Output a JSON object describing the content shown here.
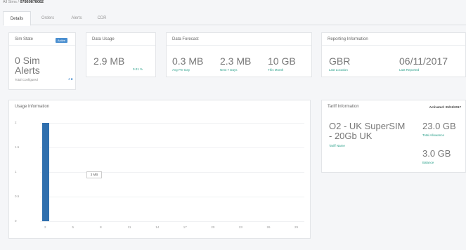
{
  "breadcrumb": {
    "root": "All Sims",
    "sep": "/",
    "current": "07860878082"
  },
  "tabs": [
    {
      "label": "Details",
      "active": true
    },
    {
      "label": "Orders",
      "active": false
    },
    {
      "label": "Alerts",
      "active": false
    },
    {
      "label": "CDR",
      "active": false
    }
  ],
  "sim_state": {
    "title": "Sim State",
    "badge": "Active",
    "alerts_value": "0 Sim",
    "alerts_value2": "Alerts",
    "alerts_label": "Total Configured",
    "alerts_count": "4"
  },
  "data_usage": {
    "title": "Data Usage",
    "value": "2.9 MB",
    "percent": "0.01 %"
  },
  "data_forecast": {
    "title": "Data Forecast",
    "items": [
      {
        "value": "0.3 MB",
        "label": "Avg Per Day"
      },
      {
        "value": "2.3 MB",
        "label": "Next 7 Days"
      },
      {
        "value": "10 GB",
        "label": "This Month"
      }
    ]
  },
  "reporting": {
    "title": "Reporting Information",
    "location_value": "GBR",
    "location_label": "Last Location",
    "date_value": "06/11/2017",
    "date_label": "Last Reported"
  },
  "usage": {
    "title": "Usage Information",
    "tooltip": "3 MB"
  },
  "tariff": {
    "title": "Tariff Information",
    "activated": "Activated: 05/11/2017",
    "name_line1": "O2 - UK SuperSIM",
    "name_line2": "- 20Gb UK",
    "name_label": "Tariff Name",
    "allowance_value": "23.0 GB",
    "allowance_label": "Total Allowance",
    "balance_value": "3.0 GB",
    "balance_label": "Balance"
  },
  "chart_data": {
    "type": "bar",
    "x": [
      "2",
      "5",
      "8",
      "11",
      "14",
      "17",
      "20",
      "23",
      "26",
      "29"
    ],
    "yticks": [
      "2",
      "1.5",
      "1",
      "0.5",
      "0"
    ],
    "ylim": [
      0,
      2
    ],
    "values": [
      2
    ],
    "categories": [
      "2"
    ],
    "color": "#2f6fae"
  }
}
